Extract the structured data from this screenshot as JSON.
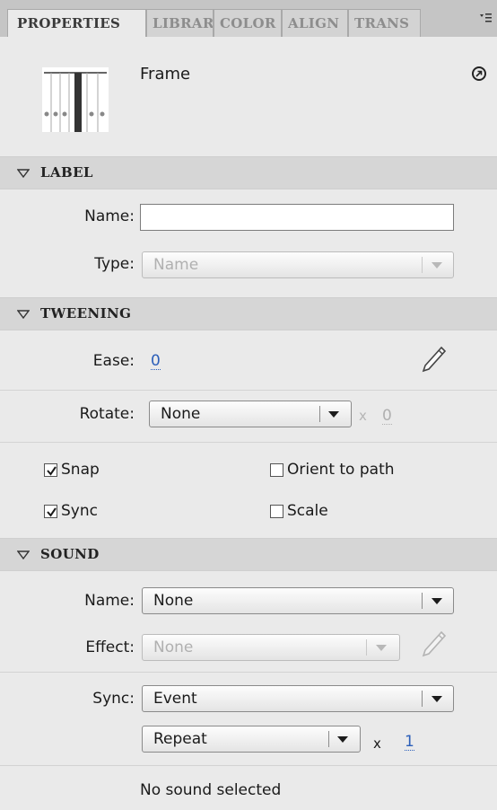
{
  "tabs": [
    {
      "label": "PROPERTIES",
      "active": true
    },
    {
      "label": "LIBRARY",
      "active": false
    },
    {
      "label": "COLOR",
      "active": false
    },
    {
      "label": "ALIGN",
      "active": false
    },
    {
      "label": "TRANS",
      "active": false
    }
  ],
  "header": {
    "title": "Frame",
    "thumbnail_icon": "frame-timeline-icon",
    "help_icon": "arrow-circle-icon"
  },
  "label_section": {
    "title": "LABEL",
    "name_label": "Name:",
    "name_value": "",
    "type_label": "Type:",
    "type_value": "Name"
  },
  "tweening_section": {
    "title": "TWEENING",
    "ease_label": "Ease:",
    "ease_value": "0",
    "rotate_label": "Rotate:",
    "rotate_value": "None",
    "rotate_times_symbol": "x",
    "rotate_count": "0",
    "snap": {
      "label": "Snap",
      "checked": true
    },
    "orient": {
      "label": "Orient to path",
      "checked": false
    },
    "sync": {
      "label": "Sync",
      "checked": true
    },
    "scale": {
      "label": "Scale",
      "checked": false
    }
  },
  "sound_section": {
    "title": "SOUND",
    "name_label": "Name:",
    "name_value": "None",
    "effect_label": "Effect:",
    "effect_value": "None",
    "sync_label": "Sync:",
    "sync_value": "Event",
    "repeat_value": "Repeat",
    "times_symbol": "x",
    "repeat_count": "1",
    "status": "No sound selected"
  },
  "colors": {
    "accent": "#2c5fb9",
    "panel": "#eaeaea",
    "section_bg": "#d6d6d6"
  }
}
